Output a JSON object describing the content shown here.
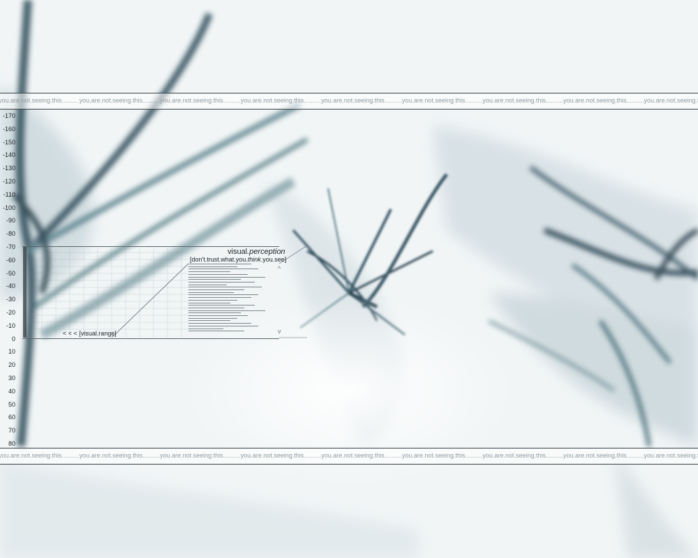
{
  "bands": {
    "repeat_text": "you.are.not.seeing.this..........you.are.not.seeing.this..........you.are.not.seeing.this..........you.are.not.seeing.this..........you.are.not.seeing.this..........you.are.not.seeing.this..........you.are.not.seeing.this..........you.are.not.seeing.this..........you.are.not.seeing.this.........."
  },
  "ruler": {
    "labels": [
      "-170",
      "-160",
      "-150",
      "-140",
      "-130",
      "-120",
      "-110",
      "-100",
      "-90",
      "-80",
      "-70",
      "-60",
      "-50",
      "-40",
      "-30",
      "-20",
      "-10",
      "0",
      "10",
      "20",
      "30",
      "40",
      "50",
      "60",
      "70",
      "80"
    ]
  },
  "panel": {
    "title_word": "visual",
    "title_italic": ".perception",
    "subtitle_pre": "[don't.trust.what.you.",
    "subtitle_italic": "think",
    "subtitle_post": ".you.see]",
    "range_link": "< < < [visual.range]",
    "scroll_up": "^",
    "scroll_down": "v"
  },
  "colors": {
    "background": "#f3f7f8",
    "streak_dark": "#1d3a48",
    "streak_teal": "#3f7a7c",
    "rule": "#3a4246"
  },
  "icons": {
    "up": "caret-up-icon",
    "down": "caret-down-icon"
  }
}
